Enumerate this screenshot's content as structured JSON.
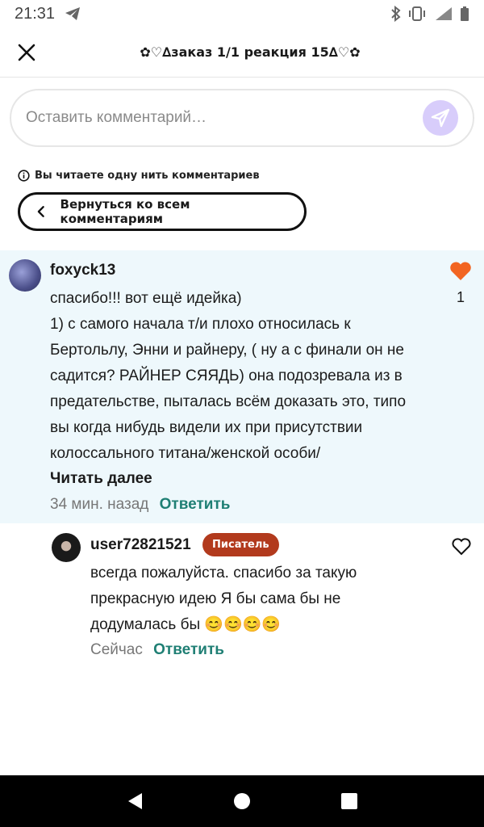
{
  "status": {
    "time": "21:31"
  },
  "header": {
    "title": "✿♡∆заказ 1/1 реакция  15∆♡✿"
  },
  "comment_input": {
    "placeholder": "Оставить комментарий…"
  },
  "thread": {
    "note": "Вы читаете одну нить комментариев",
    "back_label": "Вернуться ко всем комментариям"
  },
  "main_comment": {
    "username": "foxyck13",
    "text": "спасибо!!! вот ещё идейка)\n1)  с самого начала т/и плохо относилась к Бертольлу, Энни и райнеру, ( ну а с финали он не садится? РАЙНЕР СЯЯДЬ) она подозревала из в предательстве, пыталась всём доказать это, типо вы когда нибудь видели их при присутствии колоссального титана/женской особи/",
    "read_more": "Читать далее",
    "time": "34 мин. назад",
    "reply_label": "Ответить",
    "likes": "1",
    "liked_color": "#f26522"
  },
  "reply_comment": {
    "username": "user72821521",
    "badge": "Писатель",
    "badge_color": "#b23a1d",
    "text": "всегда пожалуйста. спасибо за такую прекрасную идею Я бы сама бы не додумалась бы 😊😊😊😊",
    "time": "Сейчас",
    "reply_label": "Ответить"
  },
  "colors": {
    "accent": "#1f7f74",
    "thread_bg": "#eef8fc",
    "send_bg": "#d8cdfb"
  }
}
